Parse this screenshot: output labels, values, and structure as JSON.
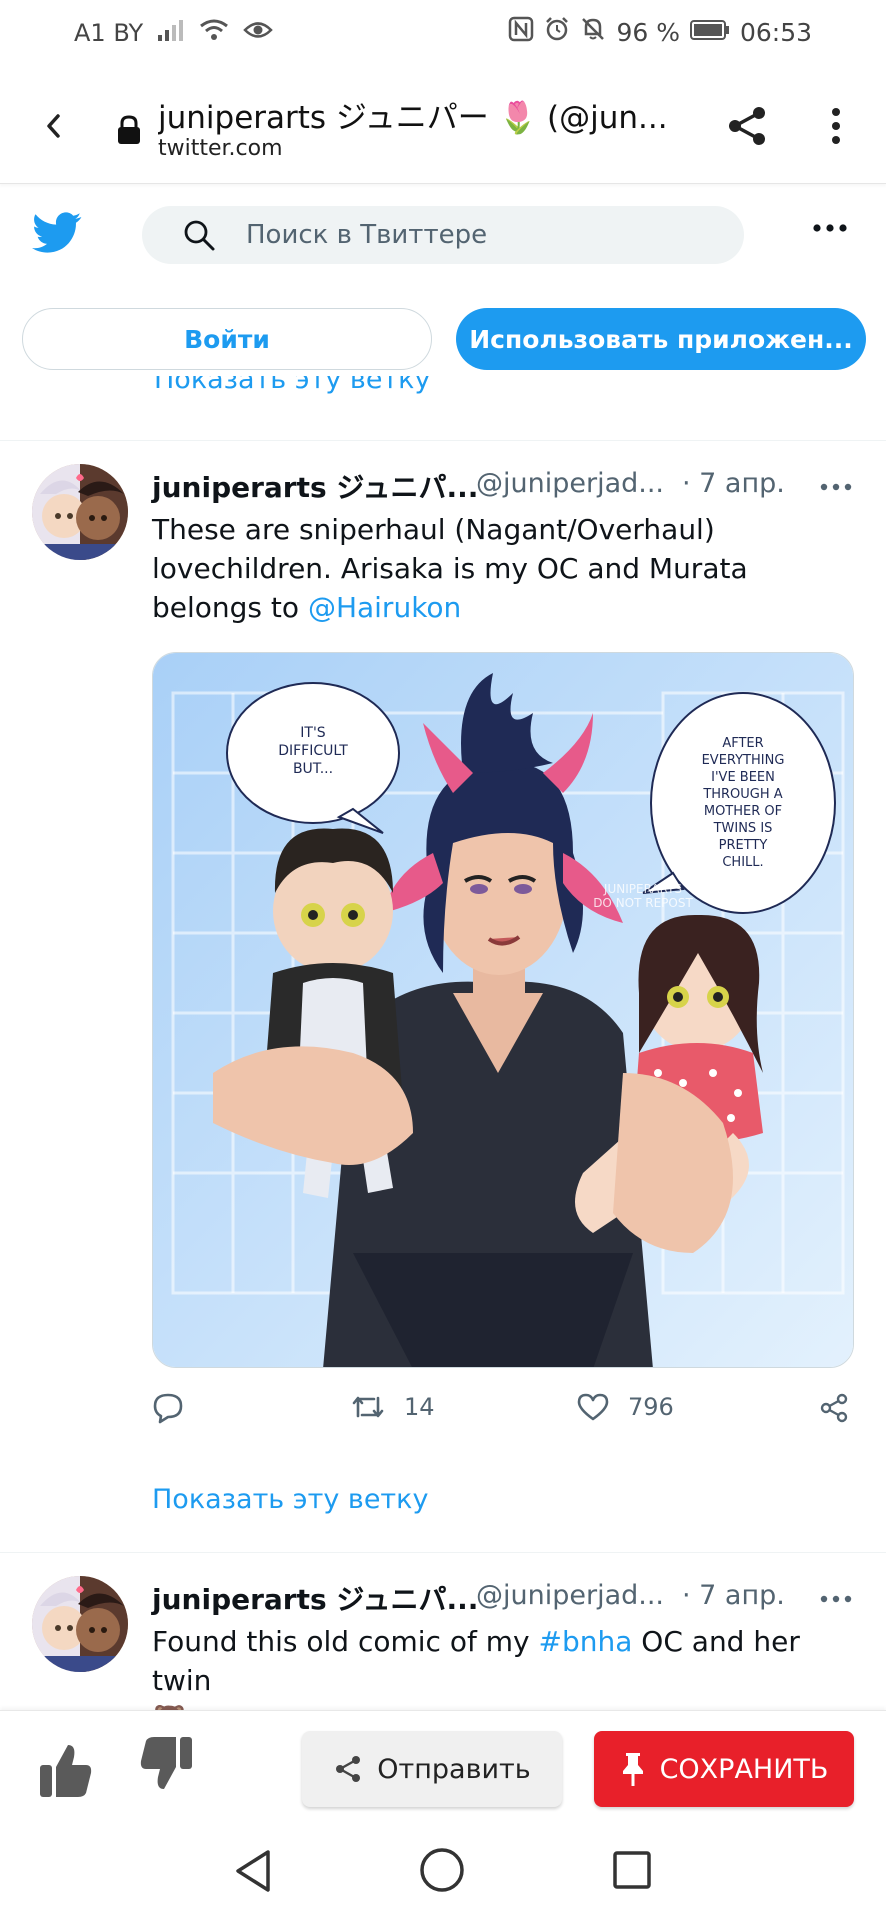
{
  "status_bar": {
    "carrier": "A1 BY",
    "battery": "96 %",
    "time": "06:53"
  },
  "browser": {
    "title": "juniperarts ジュニパー 🌷 (@jun...",
    "url": "twitter.com"
  },
  "twitter": {
    "search_placeholder": "Поиск в Твиттере",
    "login_label": "Войти",
    "app_label": "Использовать приложен...",
    "show_thread_cut": "Показать эту ветку"
  },
  "tweets": [
    {
      "name": "juniperarts ジュニパ...",
      "handle": "@juniperjad...",
      "date": "· 7 апр.",
      "text_before": "These are sniperhaul (Nagant/Overhaul) lovechildren. Arisaka is my OC and Murata belongs to ",
      "mention": "@Hairukon",
      "media": {
        "bubble_left": "IT'S DIFFICULT BUT...",
        "bubble_right": "AFTER EVERYTHING I'VE BEEN THROUGH A MOTHER OF TWINS IS PRETTY CHILL.",
        "watermark": "JUNIPERARTS DO NOT REPOST"
      },
      "retweets": "14",
      "likes": "796",
      "show_thread": "Показать эту ветку"
    },
    {
      "name": "juniperarts ジュニパ...",
      "handle": "@juniperjad...",
      "date": "· 7 апр.",
      "text_before": "Found this old comic of my ",
      "hashtag": "#bnha",
      "text_after": " OC and her twin",
      "emoji": "🐻"
    }
  ],
  "share_panel": {
    "send_label": "Отправить",
    "save_label": "СОХРАНИТЬ"
  }
}
